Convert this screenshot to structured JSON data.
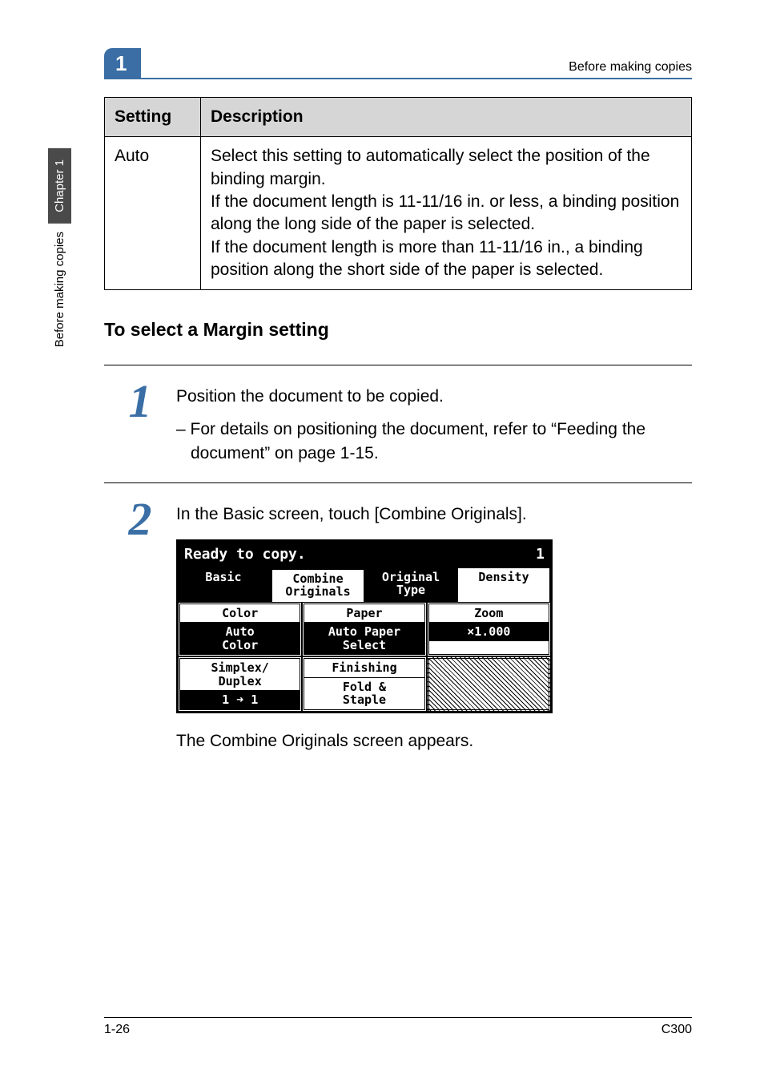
{
  "header": {
    "running_head": "Before making copies",
    "section_number": "1"
  },
  "sidebar": {
    "tab": "Chapter 1",
    "label": "Before making copies"
  },
  "table": {
    "col1_header": "Setting",
    "col2_header": "Description",
    "row1_setting": "Auto",
    "row1_desc": "Select this setting to automatically select the position of the binding margin.\nIf the document length is 11-11/16 in. or less, a binding position along the long side of the paper is selected.\nIf the document length is more than 11-11/16 in., a binding position along the short side of the paper is selected."
  },
  "subhead": "To select a Margin setting",
  "steps": {
    "s1": {
      "num": "1",
      "text": "Position the document to be copied.",
      "sub": "– For details on positioning the document, refer to “Feeding the document” on page 1-15."
    },
    "s2": {
      "num": "2",
      "text": "In the Basic screen, touch [Combine Originals].",
      "caption": "The Combine Originals screen appears."
    }
  },
  "lcd": {
    "title": "Ready to copy.",
    "title_right": "1",
    "tabs": {
      "basic": "Basic",
      "combine": "Combine\nOriginals",
      "original": "Original\nType",
      "density": "Density"
    },
    "cells": {
      "color_hdr": "Color",
      "color_val": "Auto\nColor",
      "paper_hdr": "Paper",
      "paper_val": "Auto Paper\nSelect",
      "zoom_hdr": "Zoom",
      "zoom_val": "×1.000",
      "sd_hdr": "Simplex/\nDuplex",
      "sd_val": "1 ➜ 1",
      "finishing_hdr": "Finishing",
      "finishing_val": "Fold &\nStaple"
    }
  },
  "footer": {
    "left": "1-26",
    "right": "C300"
  }
}
